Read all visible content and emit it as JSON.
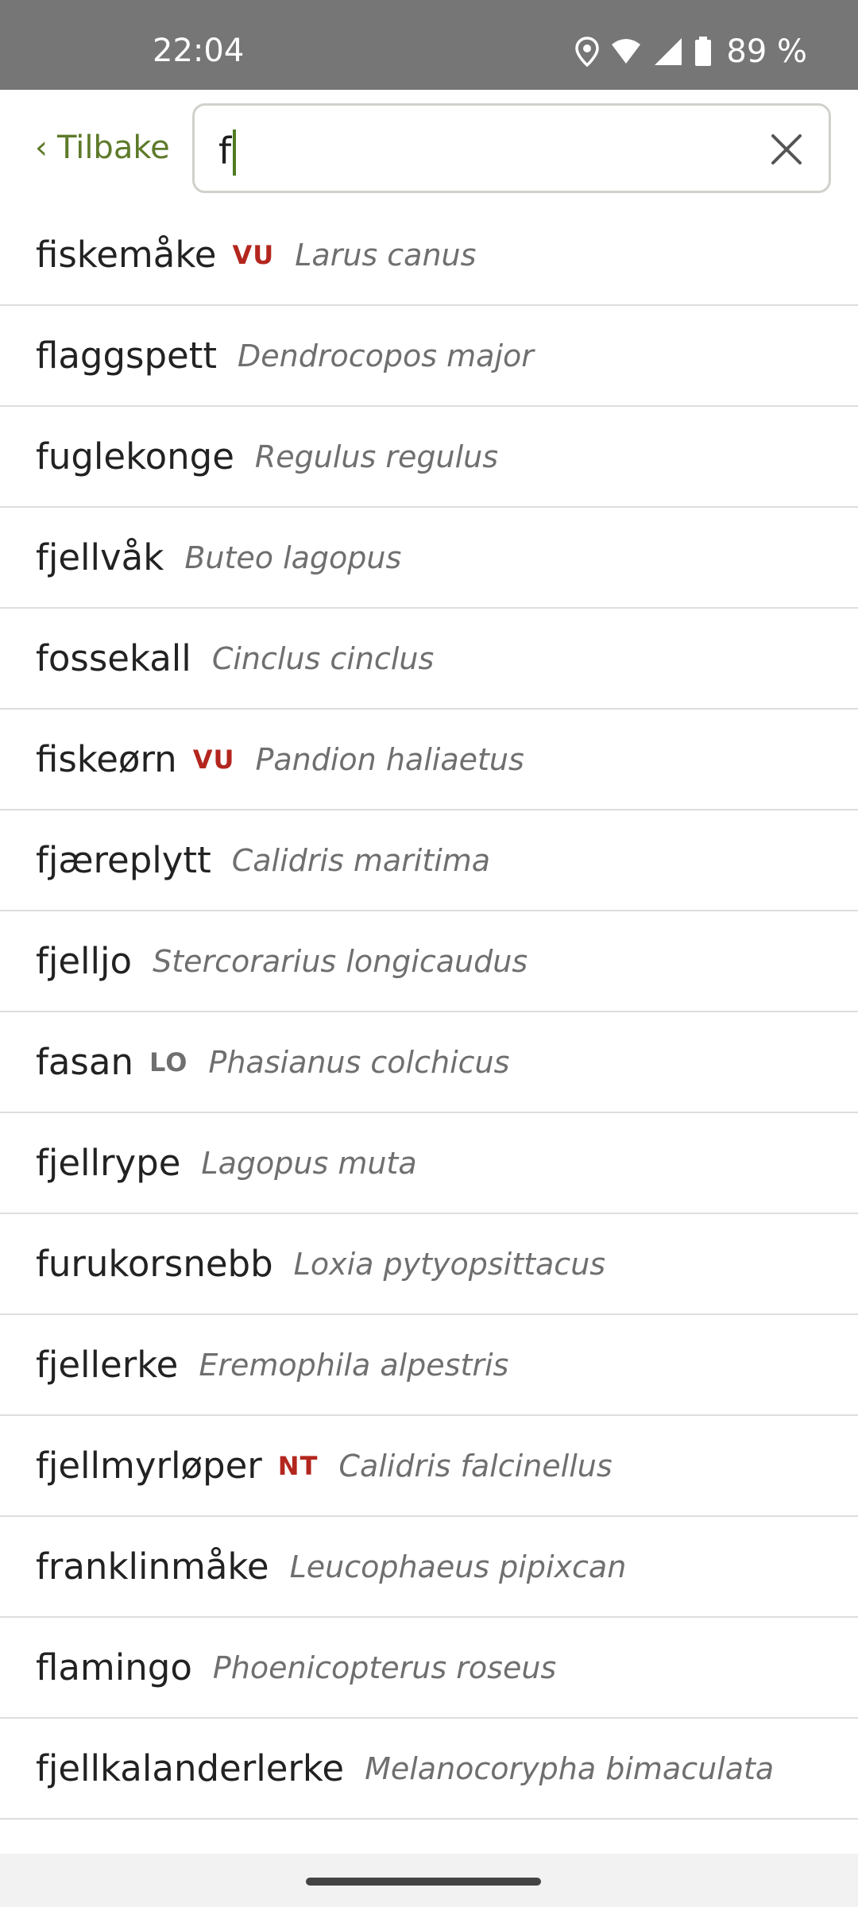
{
  "statusbar": {
    "time": "22:04",
    "battery": "89 %",
    "icons": [
      "location-icon",
      "wifi-icon",
      "signal-icon",
      "battery-icon"
    ]
  },
  "topbar": {
    "back_chevron": "‹",
    "back_label": "Tilbake",
    "search_value": "f"
  },
  "colors": {
    "accent": "#5d7a2a",
    "status_red": "#b3261e",
    "status_grey": "#6f6f6f"
  },
  "results": [
    {
      "name": "fiskemåke",
      "status": "VU",
      "status_color": "#b3261e",
      "latin": "Larus canus"
    },
    {
      "name": "flaggspett",
      "status": "",
      "status_color": "",
      "latin": "Dendrocopos major"
    },
    {
      "name": "fuglekonge",
      "status": "",
      "status_color": "",
      "latin": "Regulus regulus"
    },
    {
      "name": "fjellvåk",
      "status": "",
      "status_color": "",
      "latin": "Buteo lagopus"
    },
    {
      "name": "fossekall",
      "status": "",
      "status_color": "",
      "latin": "Cinclus cinclus"
    },
    {
      "name": "fiskeørn",
      "status": "VU",
      "status_color": "#b3261e",
      "latin": "Pandion haliaetus"
    },
    {
      "name": "fjæreplytt",
      "status": "",
      "status_color": "",
      "latin": "Calidris maritima"
    },
    {
      "name": "fjelljo",
      "status": "",
      "status_color": "",
      "latin": "Stercorarius longicaudus"
    },
    {
      "name": "fasan",
      "status": "LO",
      "status_color": "#6f6f6f",
      "latin": "Phasianus colchicus"
    },
    {
      "name": "fjellrype",
      "status": "",
      "status_color": "",
      "latin": "Lagopus muta"
    },
    {
      "name": "furukorsnebb",
      "status": "",
      "status_color": "",
      "latin": "Loxia pytyopsittacus"
    },
    {
      "name": "fjellerke",
      "status": "",
      "status_color": "",
      "latin": "Eremophila alpestris"
    },
    {
      "name": "fjellmyrløper",
      "status": "NT",
      "status_color": "#b3261e",
      "latin": "Calidris falcinellus"
    },
    {
      "name": "franklinmåke",
      "status": "",
      "status_color": "",
      "latin": "Leucophaeus pipixcan"
    },
    {
      "name": "flamingo",
      "status": "",
      "status_color": "",
      "latin": "Phoenicopterus roseus"
    },
    {
      "name": "fjellkalanderlerke",
      "status": "",
      "status_color": "",
      "latin": "Melanocorypha bimaculata"
    }
  ]
}
